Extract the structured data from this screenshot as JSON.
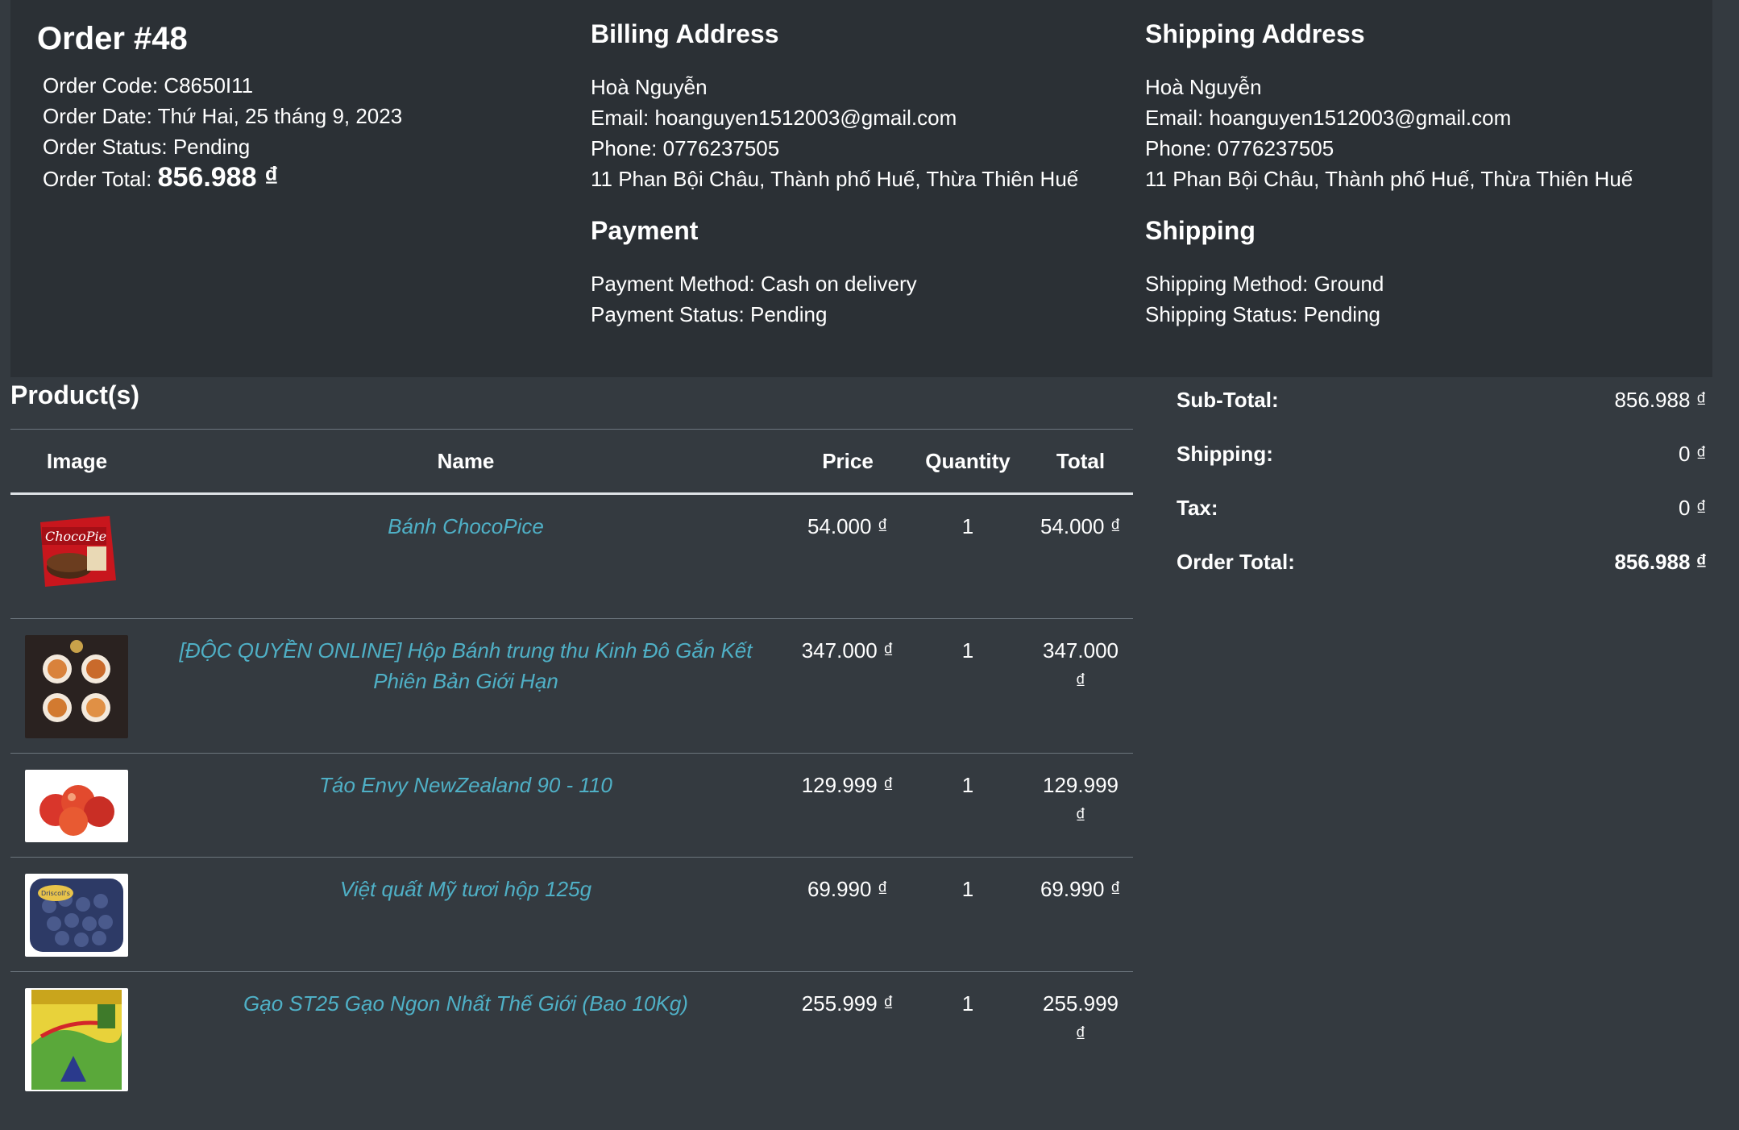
{
  "order": {
    "title": "Order #48",
    "code_line": "Order Code: C8650I11",
    "date_line": "Order Date: Thứ Hai, 25 tháng 9, 2023",
    "status_line": "Order Status: Pending",
    "total_label": "Order Total:",
    "total_value": "856.988 ₫"
  },
  "billing": {
    "heading": "Billing Address",
    "name": "Hoà Nguyễn",
    "email": "Email: hoanguyen1512003@gmail.com",
    "phone": "Phone: 0776237505",
    "address": "11 Phan Bội Châu, Thành phố Huế, Thừa Thiên Huế"
  },
  "shipping_address": {
    "heading": "Shipping Address",
    "name": "Hoà Nguyễn",
    "email": "Email: hoanguyen1512003@gmail.com",
    "phone": "Phone: 0776237505",
    "address": "11 Phan Bội Châu, Thành phố Huế, Thừa Thiên Huế"
  },
  "payment": {
    "heading": "Payment",
    "method": "Payment Method: Cash on delivery",
    "status": "Payment Status: Pending"
  },
  "shipping": {
    "heading": "Shipping",
    "method": "Shipping Method: Ground",
    "status": "Shipping Status: Pending"
  },
  "products": {
    "heading": "Product(s)",
    "columns": [
      "Image",
      "Name",
      "Price",
      "Quantity",
      "Total"
    ],
    "rows": [
      {
        "name": "Bánh ChocoPice",
        "price": "54.000 ₫",
        "quantity": "1",
        "total": "54.000 ₫",
        "thumb_label": "ChocoPie"
      },
      {
        "name": "[ĐỘC QUYỀN ONLINE] Hộp Bánh trung thu Kinh Đô Gắn Kết Phiên Bản Giới Hạn",
        "price": "347.000 ₫",
        "quantity": "1",
        "total": "347.000 ₫"
      },
      {
        "name": "Táo Envy NewZealand 90 - 110",
        "price": "129.999 ₫",
        "quantity": "1",
        "total": "129.999 ₫"
      },
      {
        "name": "Việt quất Mỹ tươi hộp 125g",
        "price": "69.990 ₫",
        "quantity": "1",
        "total": "69.990 ₫",
        "thumb_label": "Driscoll's"
      },
      {
        "name": "Gạo ST25 Gạo Ngon Nhất Thế Giới (Bao 10Kg)",
        "price": "255.999 ₫",
        "quantity": "1",
        "total": "255.999 ₫"
      }
    ]
  },
  "summary": {
    "subtotal_label": "Sub-Total:",
    "subtotal_value": "856.988 ₫",
    "shipping_label": "Shipping:",
    "shipping_value": "0 ₫",
    "tax_label": "Tax:",
    "tax_value": "0 ₫",
    "total_label": "Order Total:",
    "total_value": "856.988 ₫"
  },
  "colors": {
    "page_bg": "#343a40",
    "panel_bg": "#2b3035",
    "link": "#4fb0c6"
  }
}
